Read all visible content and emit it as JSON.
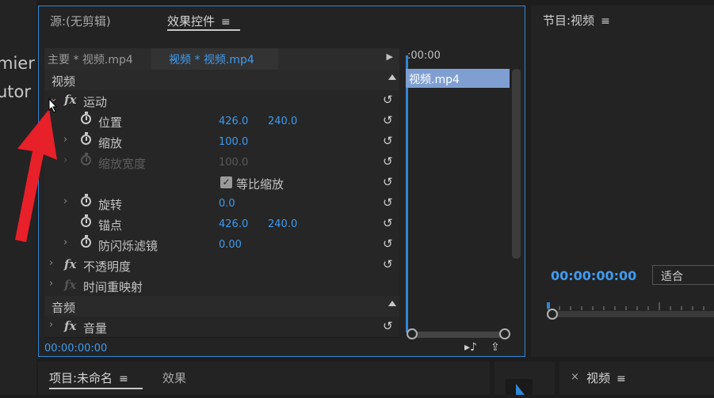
{
  "left_panel": {
    "line1": "mier",
    "line2": "utor"
  },
  "effect_panel": {
    "tab_source": "源:(无剪辑)",
    "tab_effects": "效果控件",
    "menu_glyph": "≡",
    "main_clip": "主要 * 视频.mp4",
    "seq_clip": "视频 * 视频.mp4",
    "timeline_timecode": ":00:00",
    "clip_name": "视频.mp4",
    "current_timecode": "00:00:00:00",
    "sections": {
      "video": "视频",
      "audio": "音频"
    },
    "rows": [
      {
        "label": "运动",
        "type": "fx"
      },
      {
        "label": "位置",
        "v1": "426.0",
        "v2": "240.0"
      },
      {
        "label": "缩放",
        "v1": "100.0"
      },
      {
        "label": "缩放宽度",
        "v1": "100.0",
        "disabled": true
      },
      {
        "label": "等比缩放",
        "checked": true
      },
      {
        "label": "旋转",
        "v1": "0.0"
      },
      {
        "label": "锚点",
        "v1": "426.0",
        "v2": "240.0"
      },
      {
        "label": "防闪烁滤镜",
        "v1": "0.00"
      },
      {
        "label": "不透明度",
        "type": "fx"
      },
      {
        "label": "时间重映射",
        "type": "fx",
        "disabled": true
      },
      {
        "label": "音量",
        "type": "fx"
      }
    ]
  },
  "program_monitor": {
    "title": "节目:视频",
    "timecode": "00:00:00:00",
    "fit": "适合"
  },
  "bottom": {
    "project": "项目:未命名",
    "effects": "效果",
    "close": "×",
    "seq": "视频"
  },
  "colors": {
    "accent": "#2f86d6",
    "timecode": "#3f9bf0",
    "clip": "#7f9fd3",
    "pointer_arrow": "#e8202a"
  }
}
